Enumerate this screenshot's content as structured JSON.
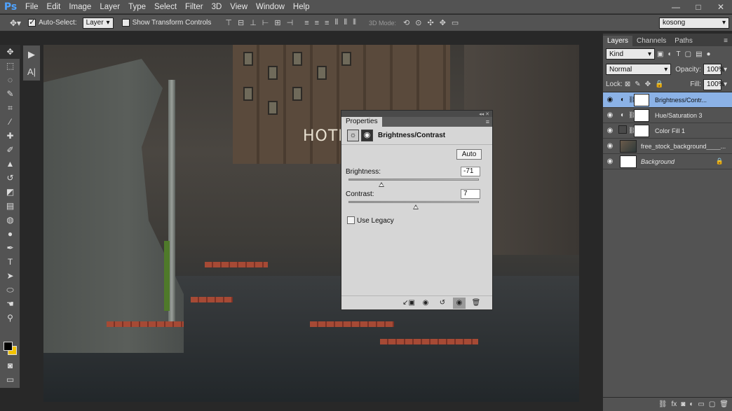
{
  "app": {
    "logo": "Ps"
  },
  "menu": [
    "File",
    "Edit",
    "Image",
    "Layer",
    "Type",
    "Select",
    "Filter",
    "3D",
    "View",
    "Window",
    "Help"
  ],
  "window_buttons": [
    "—",
    "□",
    "✕"
  ],
  "options": {
    "auto_select_label": "Auto-Select:",
    "auto_select_value": "Layer",
    "show_transform_label": "Show Transform Controls",
    "mode_label": "3D Mode:",
    "workspace": "kosong"
  },
  "tools": [
    "move",
    "marquee",
    "lasso",
    "quick-select",
    "crop",
    "eyedropper",
    "healing",
    "brush",
    "stamp",
    "history-brush",
    "eraser",
    "gradient",
    "blur",
    "dodge",
    "pen",
    "type",
    "path-select",
    "shape",
    "hand",
    "zoom"
  ],
  "canvas": {
    "sign_text": "HOTE"
  },
  "properties": {
    "tab": "Properties",
    "title": "Brightness/Contrast",
    "auto_label": "Auto",
    "brightness_label": "Brightness:",
    "brightness_value": "-71",
    "brightness_fraction": 0.245,
    "contrast_label": "Contrast:",
    "contrast_value": "7",
    "contrast_fraction": 0.51,
    "legacy_label": "Use Legacy"
  },
  "layers_panel": {
    "tabs": [
      "Layers",
      "Channels",
      "Paths"
    ],
    "kind_label": "Kind",
    "blend_mode": "Normal",
    "opacity_label": "Opacity:",
    "opacity_value": "100%",
    "lock_label": "Lock:",
    "fill_label": "Fill:",
    "fill_value": "100%",
    "layers": [
      {
        "name": "Brightness/Contr...",
        "type": "adjustment",
        "selected": true
      },
      {
        "name": "Hue/Saturation 3",
        "type": "adjustment",
        "selected": false
      },
      {
        "name": "Color Fill 1",
        "type": "fill",
        "selected": false
      },
      {
        "name": "free_stock_background____...",
        "type": "image",
        "selected": false
      },
      {
        "name": "Background",
        "type": "background",
        "selected": false
      }
    ]
  }
}
